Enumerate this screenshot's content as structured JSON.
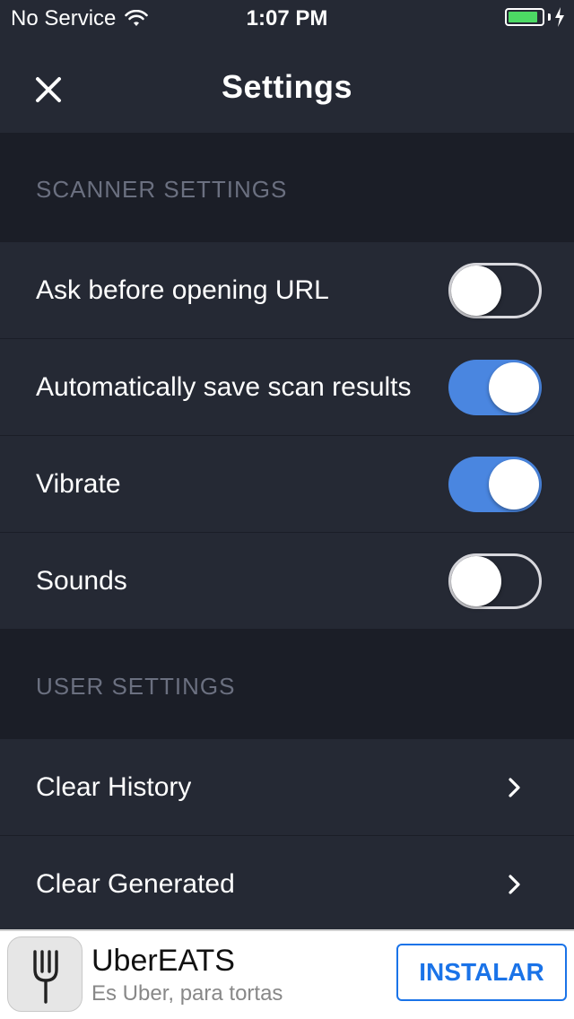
{
  "status_bar": {
    "carrier": "No Service",
    "time": "1:07 PM",
    "battery_level": 0.9,
    "battery_color": "#4cd964"
  },
  "nav": {
    "title": "Settings",
    "close_icon": "close-icon"
  },
  "scanner_section": {
    "header": "SCANNER SETTINGS",
    "rows": [
      {
        "label": "Ask before opening URL",
        "enabled": false
      },
      {
        "label": "Automatically save scan results",
        "enabled": true
      },
      {
        "label": "Vibrate",
        "enabled": true
      },
      {
        "label": "Sounds",
        "enabled": false
      }
    ]
  },
  "user_section": {
    "header": "USER SETTINGS",
    "rows": [
      {
        "label": "Clear History",
        "icon": "chevron-right-icon"
      },
      {
        "label": "Clear Generated",
        "icon": "chevron-right-icon"
      }
    ]
  },
  "ad": {
    "title": "UberEATS",
    "subtitle": "Es Uber, para tortas",
    "button": "INSTALAR",
    "icon": "fork-icon"
  },
  "colors": {
    "background": "#1b1e27",
    "row_background": "#252934",
    "toggle_on": "#4a86e0",
    "section_text": "#6b7080",
    "ad_button": "#1a73e8"
  }
}
